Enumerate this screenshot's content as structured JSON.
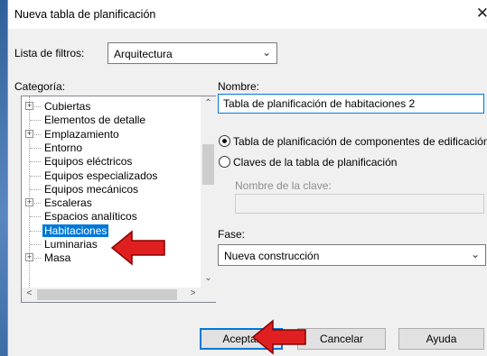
{
  "dialog": {
    "title": "Nueva tabla de planificación",
    "close_glyph": "✕"
  },
  "filter": {
    "label": "Lista de filtros:",
    "value": "Arquitectura"
  },
  "category": {
    "label": "Categoría:",
    "items": [
      {
        "label": "Cubiertas",
        "expandable": true,
        "selected": false
      },
      {
        "label": "Elementos de detalle",
        "expandable": false,
        "selected": false
      },
      {
        "label": "Emplazamiento",
        "expandable": true,
        "selected": false
      },
      {
        "label": "Entorno",
        "expandable": false,
        "selected": false
      },
      {
        "label": "Equipos eléctricos",
        "expandable": false,
        "selected": false
      },
      {
        "label": "Equipos especializados",
        "expandable": false,
        "selected": false
      },
      {
        "label": "Equipos mecánicos",
        "expandable": false,
        "selected": false
      },
      {
        "label": "Escaleras",
        "expandable": true,
        "selected": false
      },
      {
        "label": "Espacios analíticos",
        "expandable": false,
        "selected": false
      },
      {
        "label": "Habitaciones",
        "expandable": false,
        "selected": true
      },
      {
        "label": "Luminarias",
        "expandable": false,
        "selected": false
      },
      {
        "label": "Masa",
        "expandable": true,
        "selected": false
      }
    ]
  },
  "name": {
    "label": "Nombre:",
    "value": "Tabla de planificación de habitaciones 2"
  },
  "schedule_type": {
    "option_components": "Tabla de planificación de componentes de edificación",
    "option_keys": "Claves de la tabla de planificación",
    "selected": "components",
    "key_name_label": "Nombre de la clave:",
    "key_name_value": ""
  },
  "phase": {
    "label": "Fase:",
    "value": "Nueva construcción"
  },
  "buttons": {
    "ok": "Aceptar",
    "cancel": "Cancelar",
    "help": "Ayuda"
  },
  "annotation_colors": {
    "arrow_fill": "#e02020",
    "arrow_stroke": "#8a0000"
  }
}
